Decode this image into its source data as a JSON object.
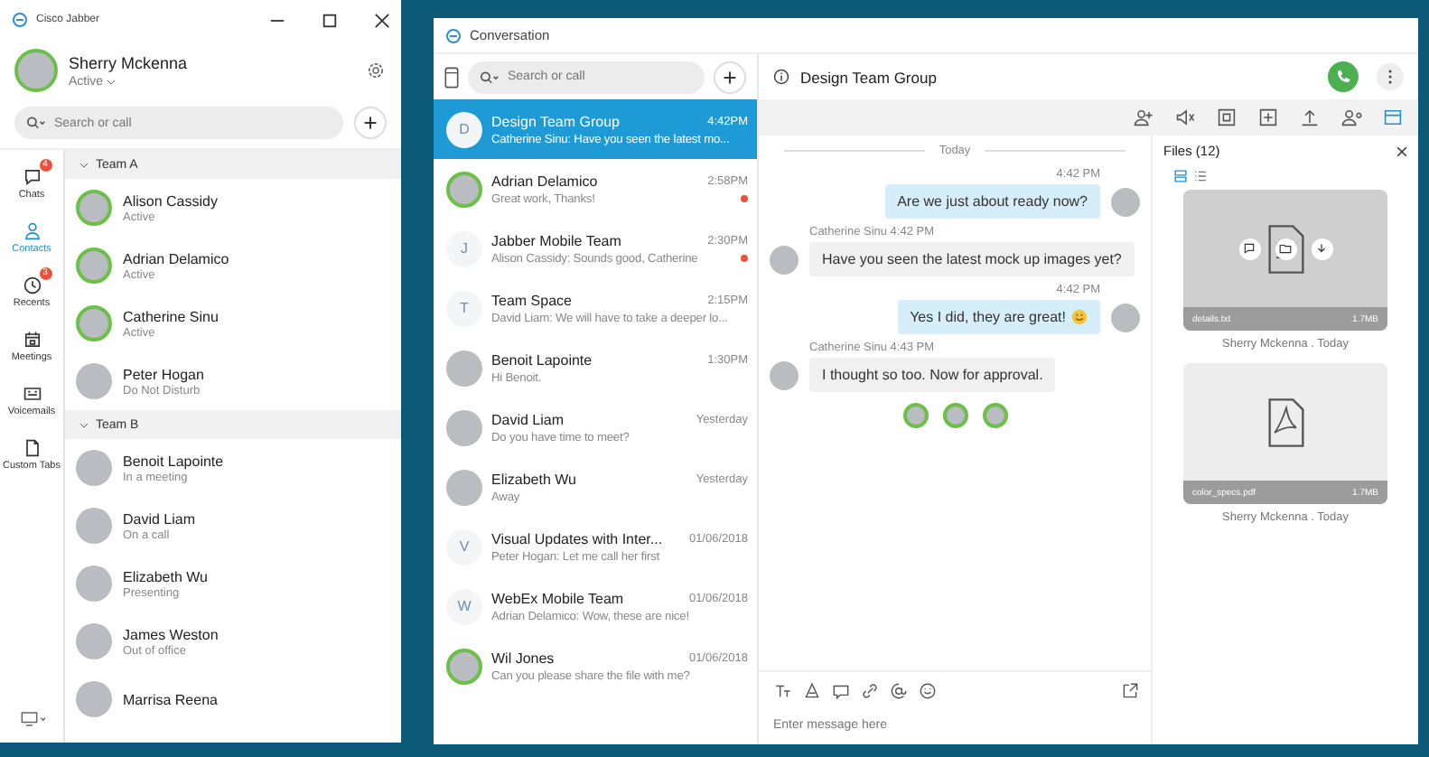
{
  "main_window": {
    "title": "Cisco Jabber",
    "user": {
      "name": "Sherry Mckenna",
      "status": "Active"
    },
    "search": {
      "placeholder": "Search or call"
    },
    "nav": [
      {
        "label": "Chats",
        "badge": "4",
        "selected": false
      },
      {
        "label": "Contacts",
        "selected": true
      },
      {
        "label": "Recents",
        "badge": "3",
        "selected": false
      },
      {
        "label": "Meetings",
        "selected": false
      },
      {
        "label": "Voicemails",
        "selected": false
      },
      {
        "label": "Custom Tabs",
        "selected": false
      }
    ],
    "groups": [
      {
        "name": "Team A",
        "expanded": true,
        "contacts": [
          {
            "name": "Alison Cassidy",
            "status": "Active",
            "ring": true
          },
          {
            "name": "Adrian Delamico",
            "status": "Active",
            "ring": true
          },
          {
            "name": "Catherine Sinu",
            "status": "Active",
            "ring": true
          },
          {
            "name": "Peter Hogan",
            "status": "Do Not Disturb",
            "ring": false
          }
        ]
      },
      {
        "name": "Team B",
        "expanded": true,
        "contacts": [
          {
            "name": "Benoit Lapointe",
            "status": "In a meeting",
            "ring": false
          },
          {
            "name": "David Liam",
            "status": "On a call",
            "ring": false
          },
          {
            "name": "Elizabeth Wu",
            "status": "Presenting",
            "ring": false
          },
          {
            "name": "James Weston",
            "status": "Out of office",
            "ring": false
          },
          {
            "name": "Marrisa Reena",
            "ring": false
          }
        ]
      }
    ]
  },
  "conversation_window": {
    "title": "Conversation",
    "search": {
      "placeholder": "Search or call"
    },
    "chats": [
      {
        "name": "Design Team Group",
        "preview": "Catherine Sinu: Have you seen the latest mo...",
        "time": "4:42PM",
        "initial": "D",
        "selected": true,
        "unread": false
      },
      {
        "name": "Adrian Delamico",
        "preview": "Great work, Thanks!",
        "time": "2:58PM",
        "selected": false,
        "unread": true,
        "ring": true
      },
      {
        "name": "Jabber Mobile Team",
        "preview": "Alison Cassidy: Sounds good, Catherine",
        "time": "2:30PM",
        "initial": "J",
        "selected": false,
        "unread": true
      },
      {
        "name": "Team Space",
        "preview": "David Liam: We will have to take a deeper lo...",
        "time": "2:15PM",
        "initial": "T",
        "selected": false,
        "unread": false
      },
      {
        "name": "Benoit Lapointe",
        "preview": "Hi Benoit.",
        "time": "1:30PM",
        "selected": false,
        "unread": false,
        "ring": false
      },
      {
        "name": "David Liam",
        "preview": "Do you have time to meet?",
        "time": "Yesterday",
        "selected": false,
        "unread": false,
        "ring": false
      },
      {
        "name": "Elizabeth Wu",
        "preview": "Away",
        "time": "Yesterday",
        "selected": false,
        "unread": false,
        "ring": false
      },
      {
        "name": "Visual Updates with Inter...",
        "preview": "Peter Hogan: Let me call her first",
        "time": "01/06/2018",
        "initial": "V",
        "selected": false,
        "unread": false
      },
      {
        "name": "WebEx Mobile Team",
        "preview": "Adrian Delamico: Wow, these are nice!",
        "time": "01/06/2018",
        "initial": "W",
        "selected": false,
        "unread": false
      },
      {
        "name": "Wil Jones",
        "preview": "Can you please share the file with me?",
        "time": "01/06/2018",
        "selected": false,
        "unread": false,
        "ring": true
      }
    ],
    "header": {
      "title": "Design Team Group"
    },
    "day_divider": "Today",
    "messages": [
      {
        "kind": "outgoing",
        "meta": "4:42 PM",
        "text": "Are we just about ready now?",
        "emoji": false
      },
      {
        "kind": "incoming",
        "meta": "Catherine Sinu 4:42 PM",
        "text": "Have you seen the latest mock up images yet?",
        "emoji": false
      },
      {
        "kind": "outgoing",
        "meta": "4:42 PM",
        "text": "Yes I did, they are great!",
        "emoji": true
      },
      {
        "kind": "incoming",
        "meta": "Catherine Sinu 4:43 PM",
        "text": "I thought so too. Now for approval.",
        "emoji": false
      }
    ],
    "composer": {
      "placeholder": "Enter message here"
    },
    "files": {
      "title": "Files (12)",
      "views": [
        {
          "selected": true
        },
        {
          "selected": false
        }
      ],
      "items": [
        {
          "kind": "text",
          "name": "details.txt",
          "size": "1.7MB",
          "caption": "Sherry Mckenna . Today",
          "hovered": true
        },
        {
          "kind": "pdf",
          "name": "color_specs.pdf",
          "size": "1.7MB",
          "caption": "Sherry Mckenna . Today",
          "hovered": false
        }
      ]
    }
  }
}
